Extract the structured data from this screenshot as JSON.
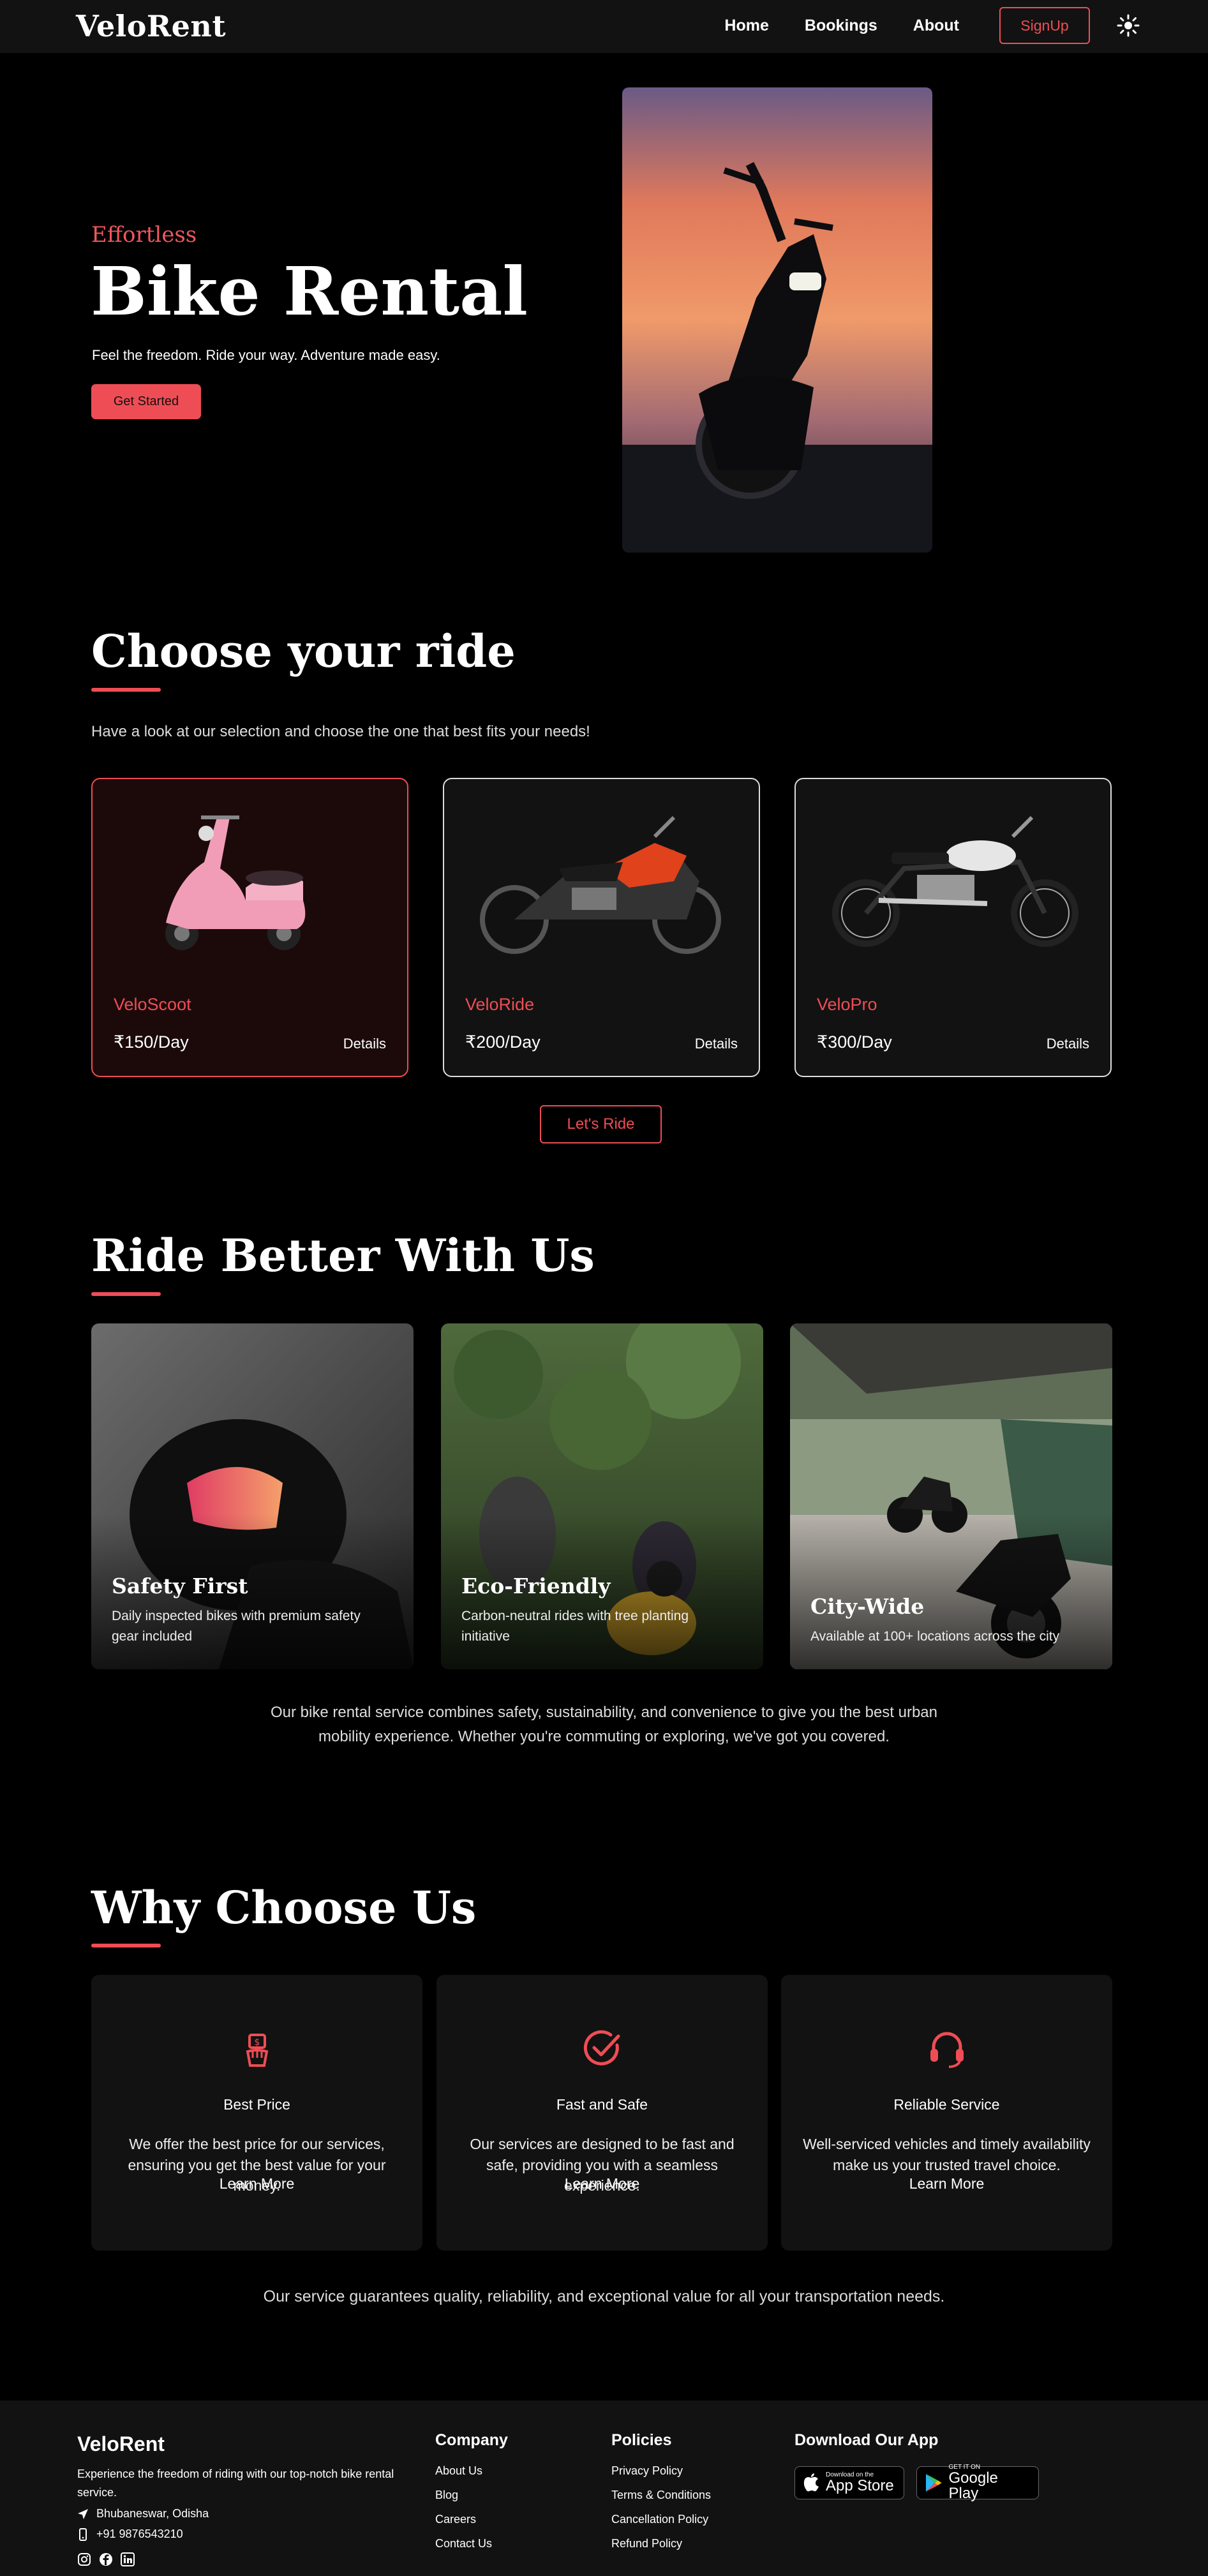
{
  "nav": {
    "brand": "VeloRent",
    "links": [
      "Home",
      "Bookings",
      "About"
    ],
    "signup": "SignUp",
    "theme_icon": "sun-icon"
  },
  "hero": {
    "eyebrow": "Effortless",
    "title": "Bike Rental",
    "tagline": "Feel the freedom. Ride your way. Adventure made easy.",
    "cta": "Get Started"
  },
  "choose": {
    "title": "Choose your ride",
    "description": "Have a look at our selection and choose the one that best fits your needs!",
    "cards": [
      {
        "name": "VeloScoot",
        "price": "₹150/Day",
        "details": "Details"
      },
      {
        "name": "VeloRide",
        "price": "₹200/Day",
        "details": "Details"
      },
      {
        "name": "VeloPro",
        "price": "₹300/Day",
        "details": "Details"
      }
    ],
    "cta": "Let's Ride"
  },
  "better": {
    "title": "Ride Better With Us",
    "cards": [
      {
        "title": "Safety First",
        "text": "Daily inspected bikes with premium safety gear included"
      },
      {
        "title": "Eco-Friendly",
        "text": "Carbon-neutral rides with tree planting initiative"
      },
      {
        "title": "City-Wide",
        "text": "Available at 100+ locations across the city"
      }
    ],
    "paragraph": "Our bike rental service combines safety, sustainability, and convenience to give you the best urban mobility experience. Whether you're commuting or exploring, we've got you covered."
  },
  "why": {
    "title": "Why Choose Us",
    "cards": [
      {
        "icon": "money-hand-icon",
        "title": "Best Price",
        "text": "We offer the best price for our services, ensuring you get the best value for your money.",
        "more": "Learn More"
      },
      {
        "icon": "check-circle-icon",
        "title": "Fast and Safe",
        "text": "Our services are designed to be fast and safe, providing you with a seamless experience.",
        "more": "Learn More"
      },
      {
        "icon": "headset-icon",
        "title": "Reliable Service",
        "text": "Well-serviced vehicles and timely availability make us your trusted travel choice.",
        "more": "Learn More"
      }
    ],
    "guarantee": "Our service guarantees quality, reliability, and exceptional value for all your transportation needs."
  },
  "footer": {
    "brand": "VeloRent",
    "description": "Experience the freedom of riding with our top-notch bike rental service.",
    "location": "Bhubaneswar, Odisha",
    "phone": "+91 9876543210",
    "company": {
      "heading": "Company",
      "links": [
        "About Us",
        "Blog",
        "Careers",
        "Contact Us"
      ]
    },
    "policies": {
      "heading": "Policies",
      "links": [
        "Privacy Policy",
        "Terms & Conditions",
        "Cancellation Policy",
        "Refund Policy"
      ]
    },
    "app": {
      "heading": "Download Our App",
      "appstore_small": "Download on the",
      "appstore_big": "App Store",
      "play_small": "GET IT ON",
      "play_big": "Google Play"
    }
  },
  "colors": {
    "accent": "#ef4d55",
    "background": "#000000",
    "surface": "#121212"
  }
}
